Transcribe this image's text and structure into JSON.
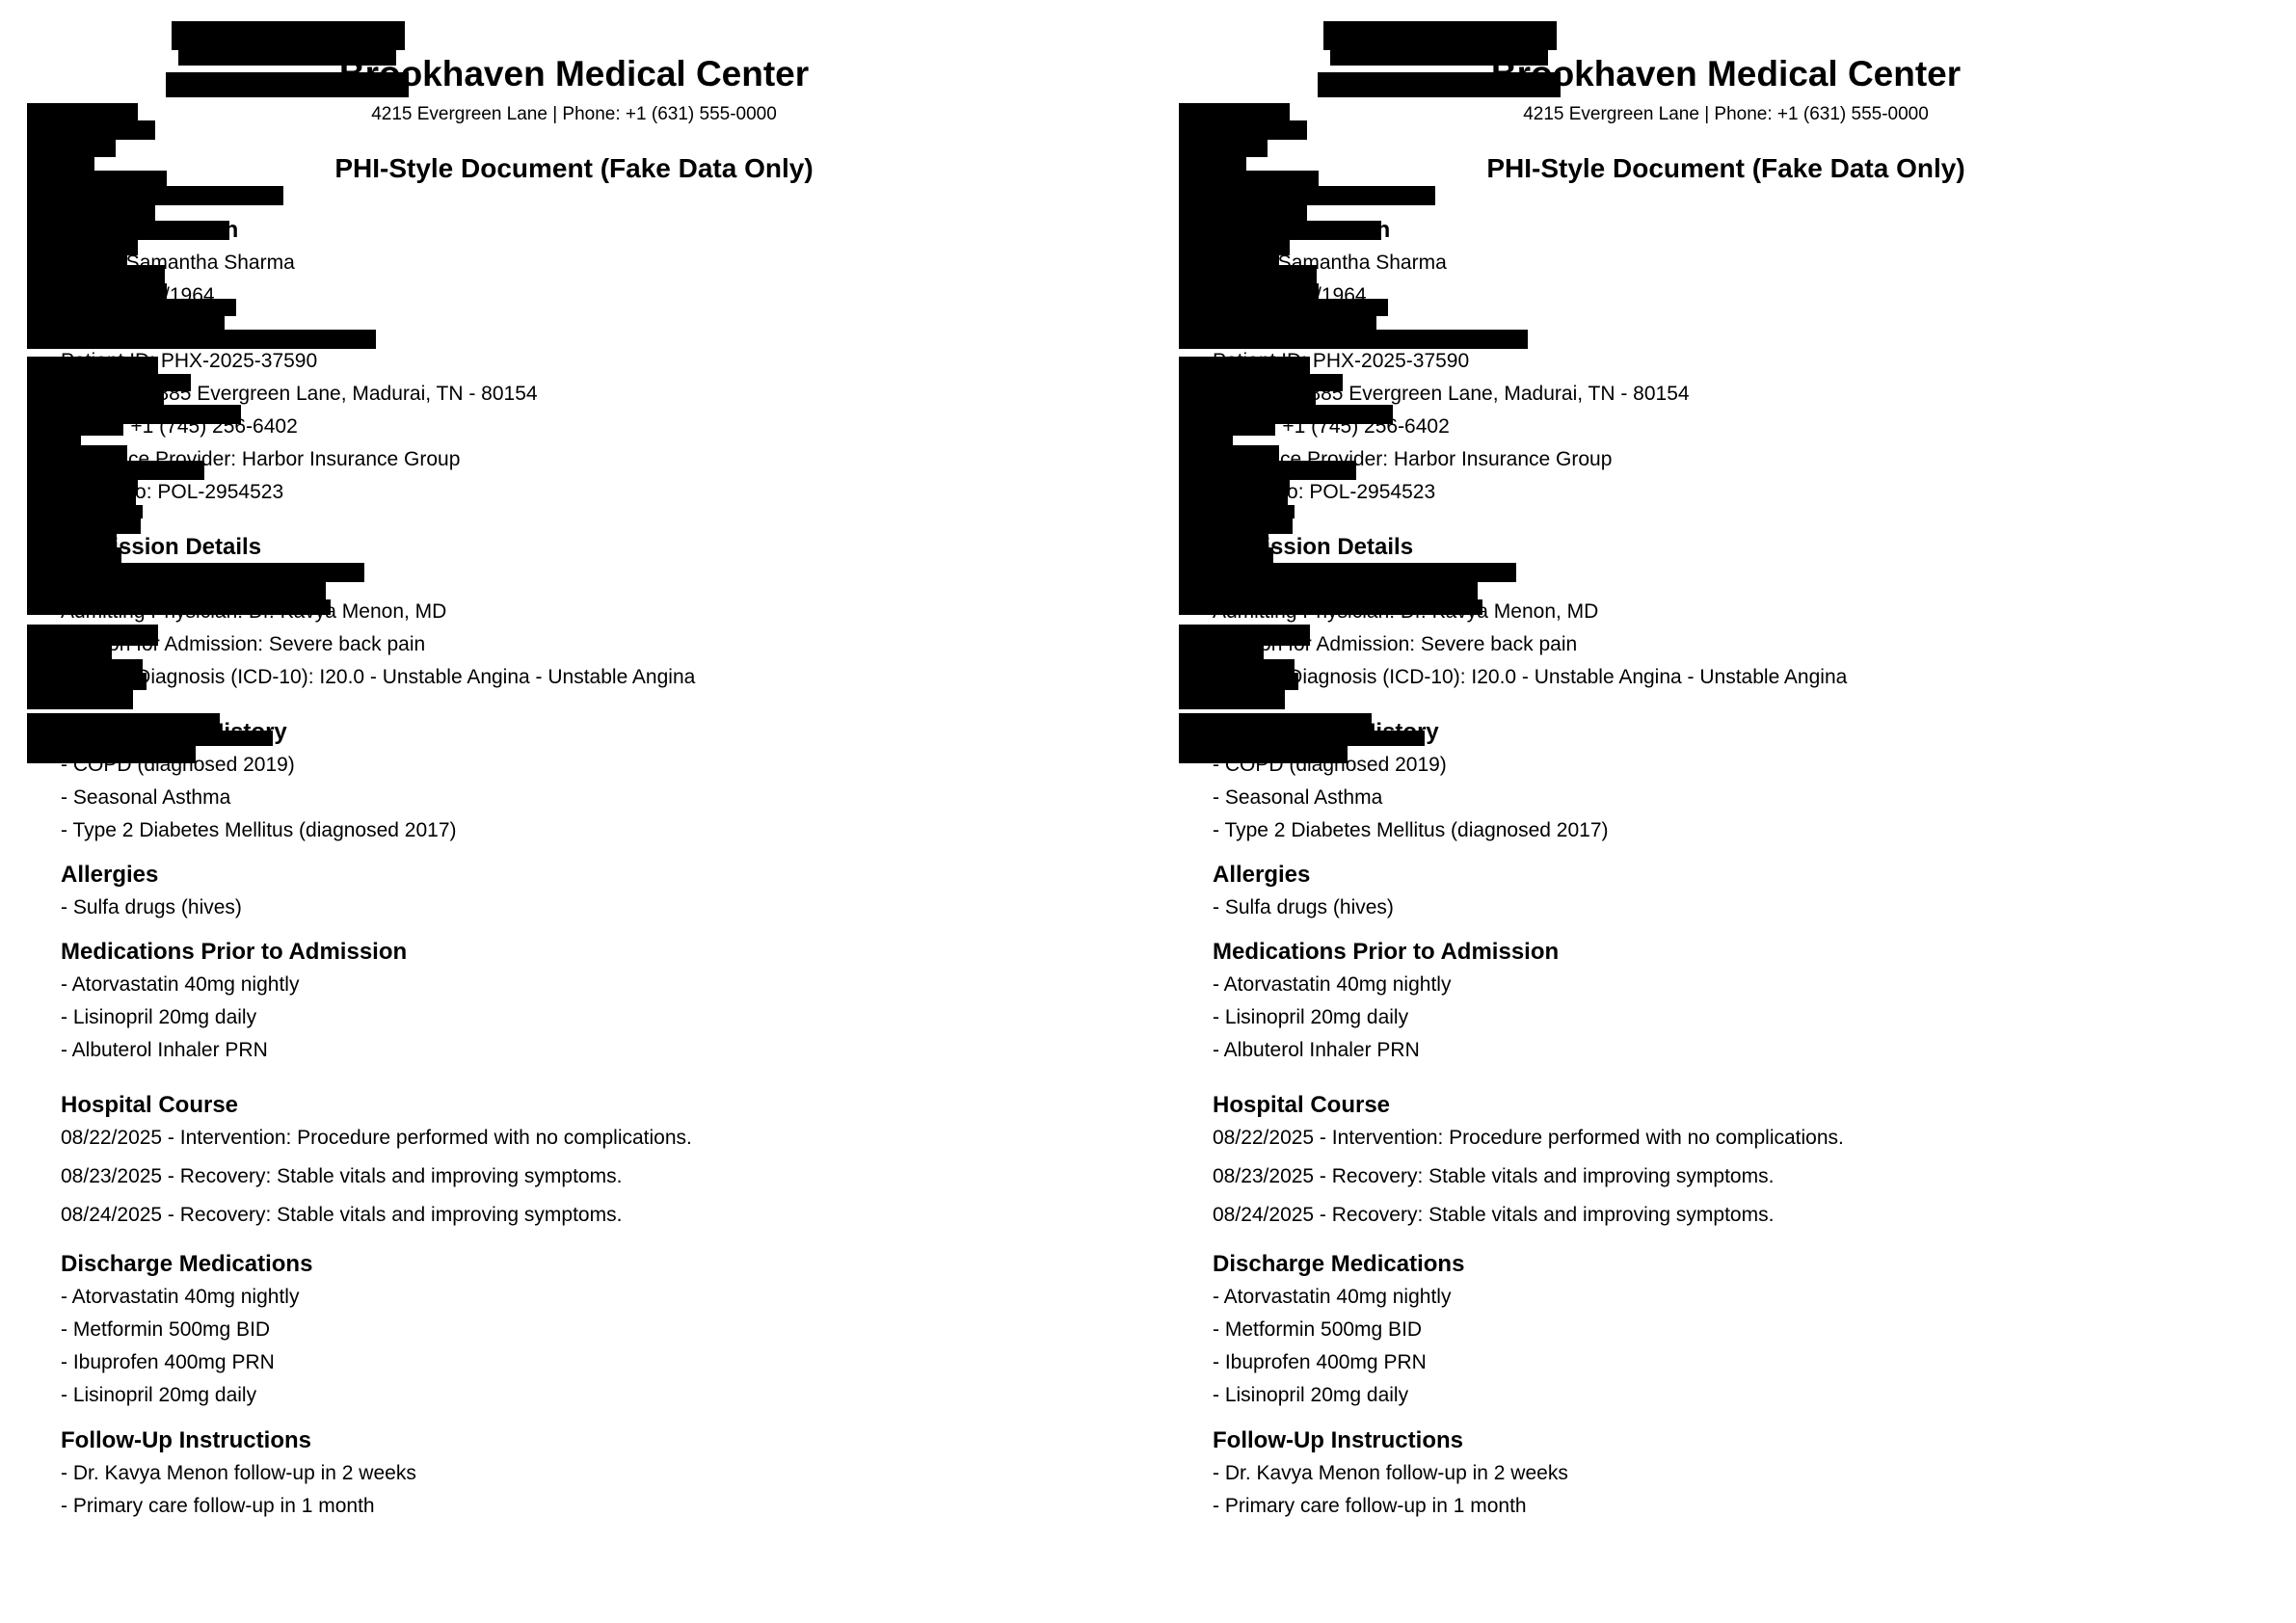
{
  "document": {
    "hospital_name": "Brookhaven Medical Center",
    "hospital_contact": "4215 Evergreen Lane | Phone: +1 (631) 555-0000",
    "title": "PHI-Style Document (Fake Data Only)",
    "patient_info": {
      "heading_fragment": "on",
      "name_line": "Name: Samantha Sharma",
      "dob_fragment": "/1964",
      "patient_id_line": "Patient ID: PHX-2025-37590",
      "address_line": "Address: 8885 Evergreen Lane, Madurai, TN - 80154",
      "phone_line": "Phone: +1 (745) 256-6402",
      "insurance_line": "Insurance Provider: Harbor Insurance Group",
      "policy_line": "Policy No: POL-2954523"
    },
    "admission": {
      "heading": "Admission Details",
      "physician_line": "Admitting Physician: Dr. Kavya Menon, MD",
      "reason_line": "Reason for Admission: Severe back pain",
      "diagnosis_line": "Primary Diagnosis (ICD-10): I20.0 - Unstable Angina - Unstable Angina"
    },
    "history": {
      "heading": "Past Medical History",
      "items": [
        "- COPD (diagnosed 2019)",
        "- Seasonal Asthma",
        "- Type 2 Diabetes Mellitus (diagnosed 2017)"
      ]
    },
    "allergies": {
      "heading": "Allergies",
      "items": [
        "- Sulfa drugs (hives)"
      ]
    },
    "prior_meds": {
      "heading": "Medications Prior to Admission",
      "items": [
        "- Atorvastatin 40mg nightly",
        "- Lisinopril 20mg daily",
        "- Albuterol Inhaler PRN"
      ]
    },
    "course": {
      "heading": "Hospital Course",
      "items": [
        "08/22/2025 - Intervention: Procedure performed with no complications.",
        "08/23/2025 - Recovery: Stable vitals and improving symptoms.",
        "08/24/2025 - Recovery: Stable vitals and improving symptoms."
      ]
    },
    "discharge_meds": {
      "heading": "Discharge Medications",
      "items": [
        "- Atorvastatin 40mg nightly",
        "- Metformin 500mg BID",
        "- Ibuprofen 400mg PRN",
        "- Lisinopril 20mg daily"
      ]
    },
    "follow_up": {
      "heading": "Follow-Up Instructions",
      "items": [
        "- Dr. Kavya Menon follow-up in 2 weeks",
        "- Primary care follow-up in 1 month"
      ]
    }
  }
}
